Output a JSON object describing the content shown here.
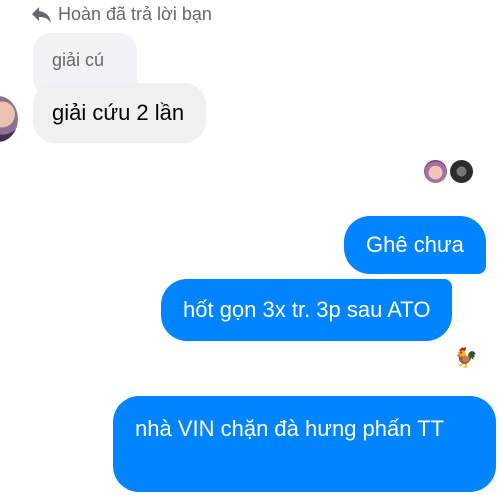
{
  "reply_header": {
    "text": "Hoàn đã trả lời bạn",
    "icon": "reply-arrow-icon"
  },
  "quoted_message": {
    "text": "giải cú"
  },
  "incoming_message": {
    "text": "giải cứu 2 lần"
  },
  "outgoing_messages": [
    {
      "text": "Ghê chưa"
    },
    {
      "text": "hốt gọn 3x tr. 3p sau ATO"
    },
    {
      "text": "nhà VIN chặn đà hưng phấn TT"
    }
  ],
  "reaction": {
    "emoji": "🐓"
  },
  "colors": {
    "outgoing_bubble": "#0084ff",
    "incoming_bubble": "#f0f0f0",
    "muted_text": "#65676b"
  }
}
